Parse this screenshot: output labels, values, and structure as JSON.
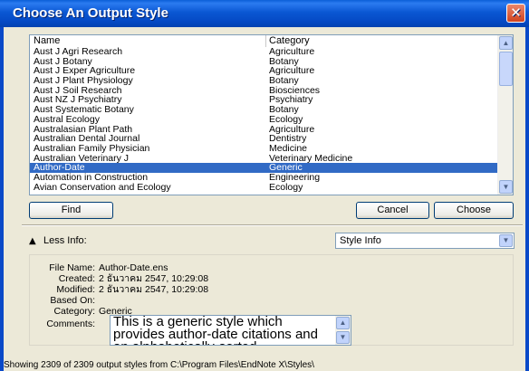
{
  "window": {
    "title": "Choose An Output Style",
    "close_glyph": "✕"
  },
  "list": {
    "columns": {
      "name": "Name",
      "category": "Category"
    },
    "rows": [
      {
        "name": "Aust J Agri Research",
        "category": "Agriculture"
      },
      {
        "name": "Aust J Botany",
        "category": "Botany"
      },
      {
        "name": "Aust J Exper Agriculture",
        "category": "Agriculture"
      },
      {
        "name": "Aust J Plant Physiology",
        "category": "Botany"
      },
      {
        "name": "Aust J Soil Research",
        "category": "Biosciences"
      },
      {
        "name": "Aust NZ J Psychiatry",
        "category": "Psychiatry"
      },
      {
        "name": "Aust Systematic Botany",
        "category": "Botany"
      },
      {
        "name": "Austral Ecology",
        "category": "Ecology"
      },
      {
        "name": "Australasian Plant Path",
        "category": "Agriculture"
      },
      {
        "name": "Australian Dental Journal",
        "category": "Dentistry"
      },
      {
        "name": "Australian Family Physician",
        "category": "Medicine"
      },
      {
        "name": "Australian Veterinary J",
        "category": "Veterinary Medicine"
      },
      {
        "name": "Author-Date",
        "category": "Generic"
      },
      {
        "name": "Automation in Construction",
        "category": "Engineering"
      },
      {
        "name": "Avian Conservation and Ecology",
        "category": "Ecology"
      }
    ],
    "selected_index": 12,
    "selection_color": "#316ac5"
  },
  "buttons": {
    "find": "Find",
    "cancel": "Cancel",
    "choose": "Choose"
  },
  "info_toggle": {
    "label": "Less Info:",
    "icon": "up-arrow"
  },
  "info_select": {
    "value": "Style Info"
  },
  "info": {
    "file_name_label": "File Name:",
    "file_name": "Author-Date.ens",
    "created_label": "Created:",
    "created": "2 ธันวาคม 2547, 10:29:08",
    "modified_label": "Modified:",
    "modified": "2 ธันวาคม 2547, 10:29:08",
    "based_on_label": "Based On:",
    "based_on": "",
    "category_label": "Category:",
    "category": "Generic",
    "comments_label": "Comments:",
    "comments": "This is a generic style which provides author-date citations and an alphabetically-sorted bibliography."
  },
  "status": {
    "text": "Showing 2309 of 2309 output styles from C:\\Program Files\\EndNote X\\Styles\\"
  }
}
